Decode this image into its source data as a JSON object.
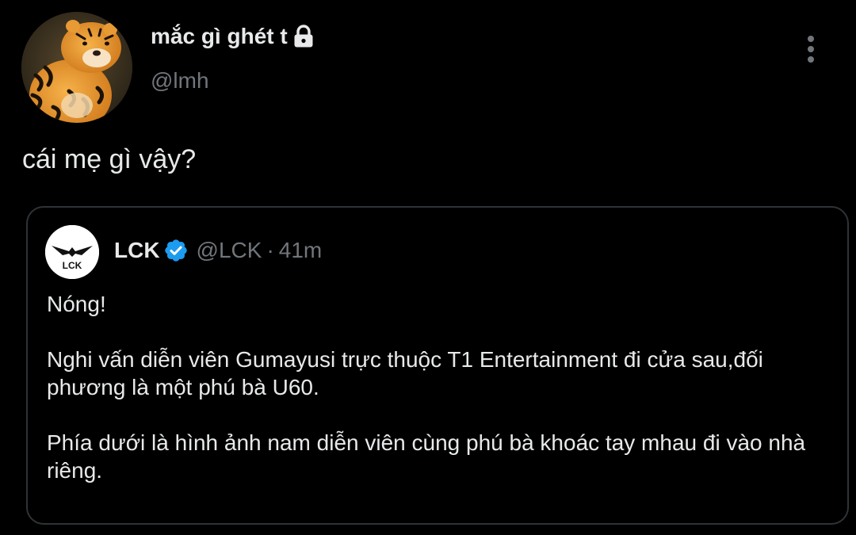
{
  "author": {
    "display_name": "mắc gì ghét t",
    "handle": "@lmh",
    "avatar": "tiger-avatar",
    "protected_icon": "lock-icon"
  },
  "menu_icon": "more-vertical-icon",
  "tweet": {
    "text": "cái mẹ gì vậy?"
  },
  "quoted": {
    "avatar": "lck-logo",
    "logo_text": "LCK",
    "name": "LCK",
    "verified_icon": "verified-badge-icon",
    "handle": "@LCK",
    "separator": "·",
    "time": "41m",
    "paragraphs": [
      "Nóng!",
      "Nghi vấn diễn viên Gumayusi trực thuộc T1 Entertainment đi cửa sau,đối phương là một phú bà U60.",
      "Phía dưới là hình ảnh nam diễn viên cùng phú bà khoác tay mhau đi vào nhà riêng."
    ]
  },
  "colors": {
    "background": "#000000",
    "text_primary": "#e7e9ea",
    "text_secondary": "#71767b",
    "border": "#2f3336",
    "verified": "#1d9bf0"
  }
}
